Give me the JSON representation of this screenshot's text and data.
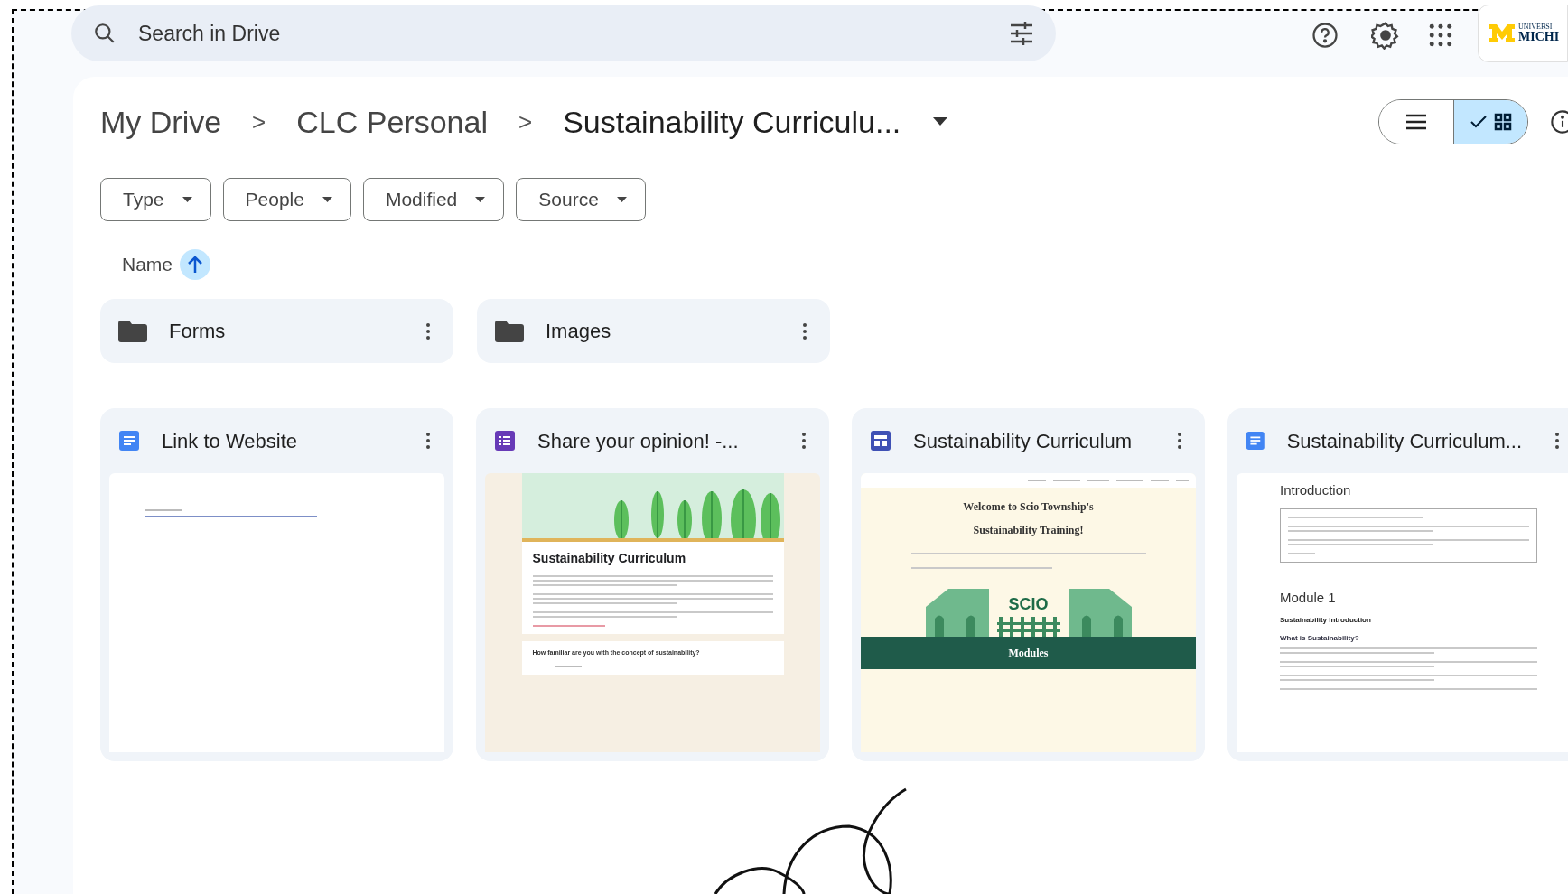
{
  "search": {
    "placeholder": "Search in Drive"
  },
  "org_logo": {
    "line_1": "UNIVERSI",
    "line_2": "MICHI"
  },
  "breadcrumb": [
    "My Drive",
    "CLC Personal",
    "Sustainability Curriculu..."
  ],
  "separators": [
    ">",
    ">"
  ],
  "view_toggle": [
    {
      "kind": "list",
      "selected": false
    },
    {
      "kind": "grid",
      "selected": true
    }
  ],
  "filters": [
    "Type",
    "People",
    "Modified",
    "Source"
  ],
  "sort": {
    "label": "Name"
  },
  "folders": [
    {
      "name": "Forms"
    },
    {
      "name": "Images"
    }
  ],
  "files": [
    {
      "kind": "doc",
      "title": "Link to Website",
      "preview": {
        "kind": "link"
      }
    },
    {
      "kind": "form",
      "title": "Share your opinion! -...",
      "preview": {
        "kind": "form",
        "heading": "Sustainability Curriculum",
        "question": "How familiar are you with the concept of sustainability?"
      }
    },
    {
      "kind": "site",
      "title": "Sustainability Curriculum",
      "preview": {
        "kind": "site",
        "heading_1": "Welcome to Scio Township's",
        "heading_2": "Sustainability Training!",
        "logo": "SCIO",
        "banner": "Modules"
      }
    },
    {
      "kind": "doc",
      "title": "Sustainability Curriculum...",
      "preview": {
        "kind": "doc",
        "heading_1": "Introduction",
        "heading_2": "Module 1",
        "subheading": "Sustainability Introduction",
        "question": "What is Sustainability?"
      }
    }
  ]
}
